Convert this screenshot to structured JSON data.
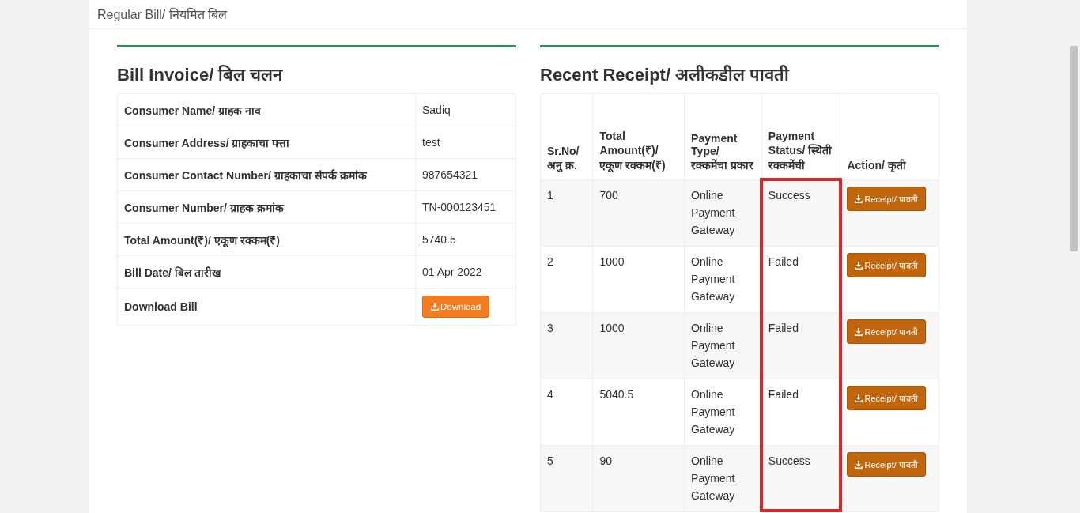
{
  "page_title": "Regular Bill/ नियमित बिल",
  "bill_invoice": {
    "title": "Bill Invoice/ बिल चलन",
    "rows": [
      {
        "label": "Consumer Name/ ग्राहक नाव",
        "value": "Sadiq"
      },
      {
        "label": "Consumer Address/ ग्राहकाचा पत्ता",
        "value": "test"
      },
      {
        "label": "Consumer Contact Number/ ग्राहकाचा संपर्क क्रमांक",
        "value": "987654321"
      },
      {
        "label": "Consumer Number/ ग्राहक क्रमांक",
        "value": "TN-000123451"
      },
      {
        "label": "Total Amount(₹)/ एकूण रक्कम(₹)",
        "value": "5740.5"
      },
      {
        "label": "Bill Date/ बिल तारीख",
        "value": "01 Apr 2022"
      }
    ],
    "download": {
      "label": "Download Bill",
      "button": "Download"
    }
  },
  "recent_receipt": {
    "title": "Recent Receipt/ अलीकडील पावती",
    "columns": [
      {
        "label": "Sr.No/ अनु क्र.",
        "highlighted": false
      },
      {
        "label": "Total Amount(₹)/ एकूण रक्कम(₹)",
        "highlighted": false
      },
      {
        "label": "Payment Type/ रक्कमेंचा प्रकार",
        "highlighted": false
      },
      {
        "label": "Payment Status/ स्थिती रक्कमेंची",
        "highlighted": true
      },
      {
        "label": "Action/ कृती",
        "highlighted": false
      }
    ],
    "rows": [
      {
        "sr": "1",
        "amount": "700",
        "type": "Online Payment Gateway",
        "status": "Success",
        "action": "Receipt/ पावती"
      },
      {
        "sr": "2",
        "amount": "1000",
        "type": "Online Payment Gateway",
        "status": "Failed",
        "action": "Receipt/ पावती"
      },
      {
        "sr": "3",
        "amount": "1000",
        "type": "Online Payment Gateway",
        "status": "Failed",
        "action": "Receipt/ पावती"
      },
      {
        "sr": "4",
        "amount": "5040.5",
        "type": "Online Payment Gateway",
        "status": "Failed",
        "action": "Receipt/ पावती"
      },
      {
        "sr": "5",
        "amount": "90",
        "type": "Online Payment Gateway",
        "status": "Success",
        "action": "Receipt/ पावती"
      }
    ]
  }
}
